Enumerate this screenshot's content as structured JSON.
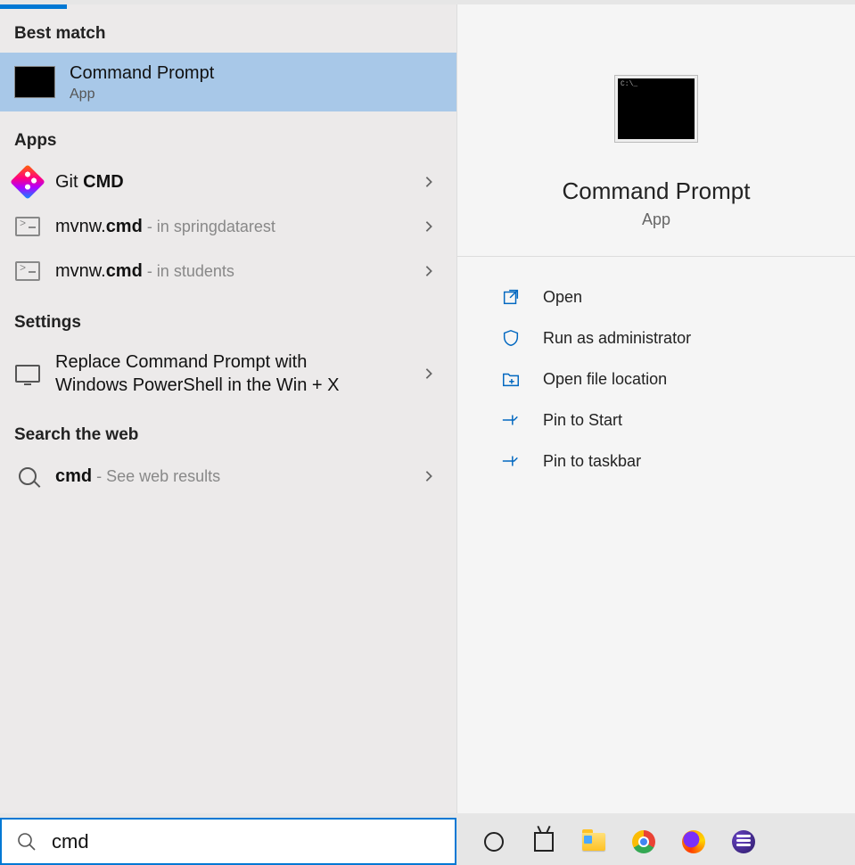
{
  "left": {
    "best_match_header": "Best match",
    "best_match": {
      "title": "Command Prompt",
      "sub": "App"
    },
    "apps_header": "Apps",
    "apps": [
      {
        "pre": "Git ",
        "bold": "CMD",
        "loc": ""
      },
      {
        "pre": "mvnw.",
        "bold": "cmd",
        "loc": " - in springdatarest"
      },
      {
        "pre": "mvnw.",
        "bold": "cmd",
        "loc": " - in students"
      }
    ],
    "settings_header": "Settings",
    "settings": [
      {
        "text": "Replace Command Prompt with Windows PowerShell in the Win + X"
      }
    ],
    "web_header": "Search the web",
    "web": [
      {
        "bold": "cmd",
        "loc": " - See web results"
      }
    ]
  },
  "right": {
    "title": "Command Prompt",
    "sub": "App",
    "actions": [
      "Open",
      "Run as administrator",
      "Open file location",
      "Pin to Start",
      "Pin to taskbar"
    ]
  },
  "search": {
    "value": "cmd"
  }
}
